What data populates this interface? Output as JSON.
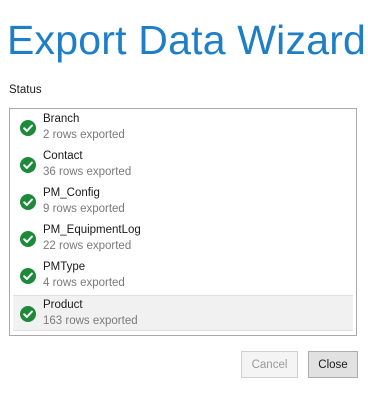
{
  "wizard": {
    "title": "Export Data Wizard",
    "status_label": "Status"
  },
  "status_items": [
    {
      "name": "Branch",
      "detail": "2 rows exported",
      "state": "success"
    },
    {
      "name": "Contact",
      "detail": "36 rows exported",
      "state": "success"
    },
    {
      "name": "PM_Config",
      "detail": "9 rows exported",
      "state": "success"
    },
    {
      "name": "PM_EquipmentLog",
      "detail": "22 rows exported",
      "state": "success"
    },
    {
      "name": "PMType",
      "detail": "4 rows exported",
      "state": "success"
    },
    {
      "name": "Product",
      "detail": "163 rows exported",
      "state": "success",
      "selected": true
    }
  ],
  "buttons": {
    "cancel_label": "Cancel",
    "close_label": "Close"
  },
  "colors": {
    "title": "#1e7fc6",
    "success_icon": "#1d8a3a"
  },
  "icons": {
    "status_success": "check-circle-icon"
  }
}
